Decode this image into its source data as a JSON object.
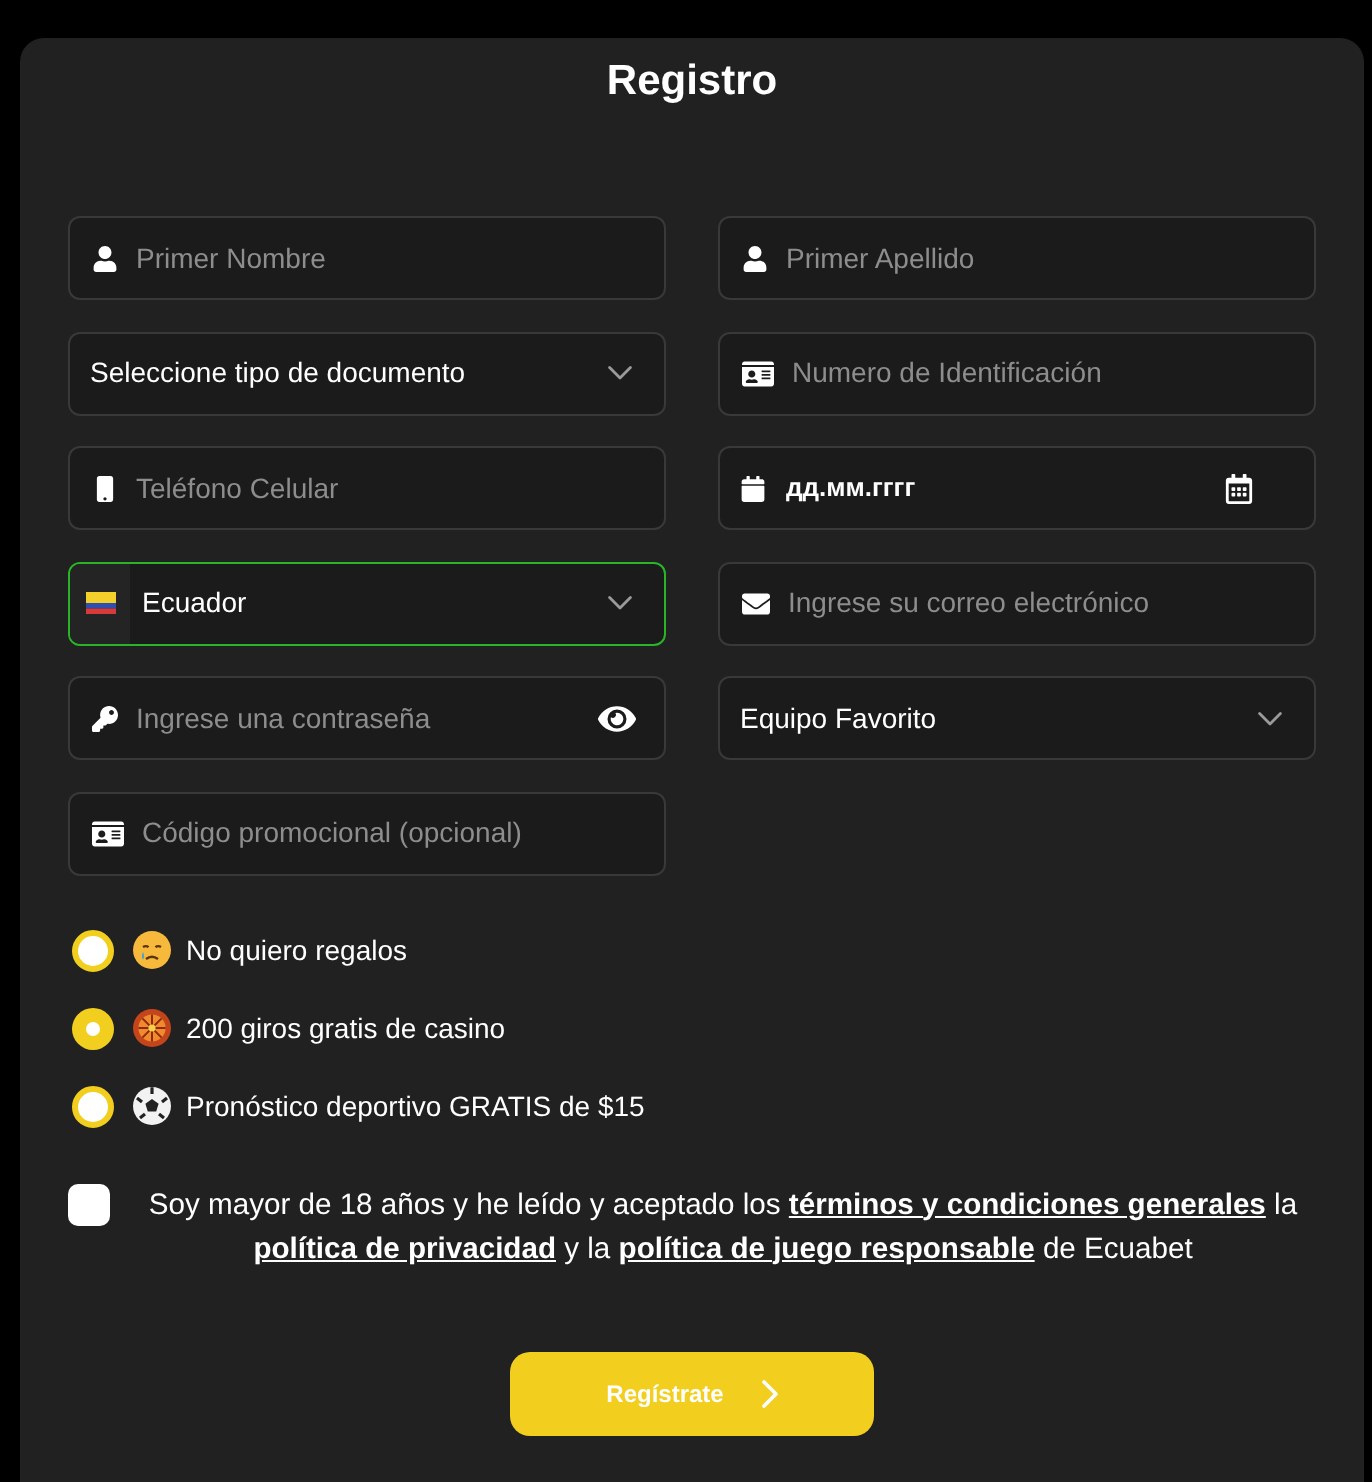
{
  "title": "Registro",
  "fields": [
    {
      "kind": "person",
      "placeholder": "Primer Nombre",
      "focused": false
    },
    {
      "kind": "person",
      "placeholder": "Primer Apellido",
      "focused": false
    },
    {
      "kind": "select",
      "value": "Seleccione tipo de documento",
      "focused": false
    },
    {
      "kind": "card",
      "placeholder": "Numero de Identificación",
      "focused": false
    },
    {
      "kind": "phone",
      "placeholder": "Teléfono Celular",
      "focused": false
    },
    {
      "kind": "date",
      "value": "дд.мм.гггг",
      "focused": false
    },
    {
      "kind": "country",
      "value": "Ecuador",
      "focused": true
    },
    {
      "kind": "email",
      "placeholder": "Ingrese su correo electrónico",
      "focused": false
    },
    {
      "kind": "password",
      "placeholder": "Ingrese una contraseña",
      "focused": false
    },
    {
      "kind": "select",
      "value": "Equipo Favorito",
      "focused": false
    },
    {
      "kind": "card",
      "placeholder": "Código promocional (opcional)",
      "focused": false
    }
  ],
  "gift_options": [
    {
      "kind": "none",
      "label": "No quiero regalos",
      "selected": false
    },
    {
      "kind": "casino",
      "label": "200 giros gratis de casino",
      "selected": true
    },
    {
      "kind": "sports",
      "label": "Pronóstico deportivo GRATIS de $15",
      "selected": false
    }
  ],
  "consent": {
    "checked": false,
    "segments": [
      {
        "kind": "text",
        "text": "Soy mayor de 18 años y he leído y aceptado los"
      },
      {
        "kind": "link",
        "text": "términos y condiciones generales"
      },
      {
        "kind": "text",
        "text": "la"
      },
      {
        "kind": "link",
        "text": "política de privacidad"
      },
      {
        "kind": "text",
        "text": "y la"
      },
      {
        "kind": "link",
        "text": "política de juego responsable"
      },
      {
        "kind": "text",
        "text": "de Ecuabet"
      }
    ]
  },
  "submit": {
    "label": "Regístrate"
  }
}
